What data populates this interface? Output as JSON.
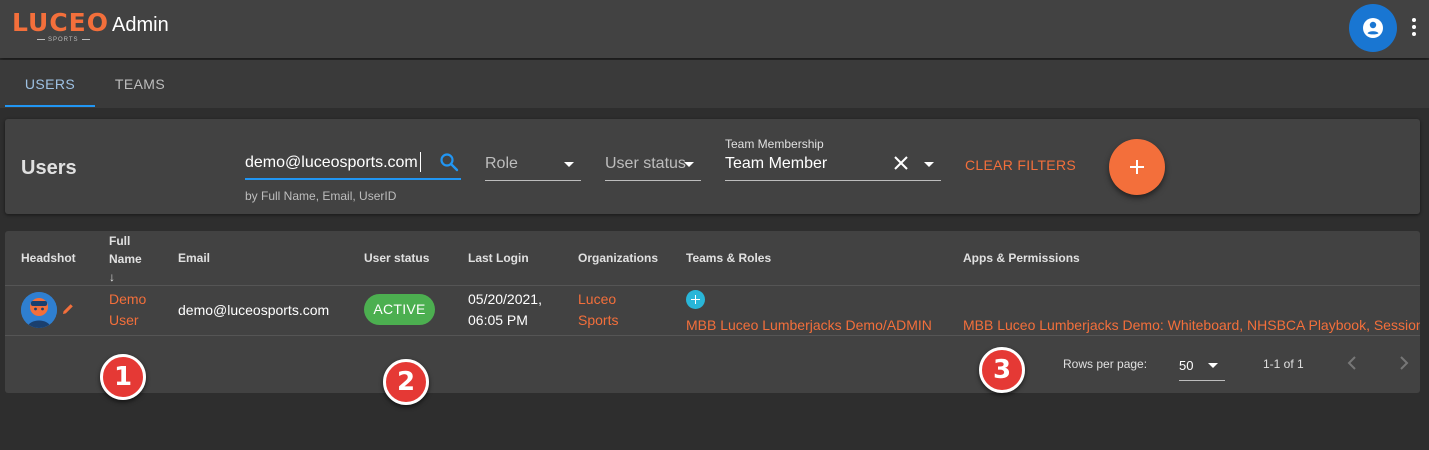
{
  "app": {
    "logo_text": "LUCEO",
    "logo_subtext": "SPORTS",
    "title": "Admin"
  },
  "tabs": [
    {
      "label": "USERS",
      "active": true
    },
    {
      "label": "TEAMS",
      "active": false
    }
  ],
  "filters": {
    "heading": "Users",
    "search_value": "demo@luceosports.com",
    "search_helper": "by Full Name, Email, UserID",
    "role_placeholder": "Role",
    "status_placeholder": "User status",
    "team_label": "Team Membership",
    "team_value": "Team Member",
    "clear_label": "CLEAR FILTERS"
  },
  "table": {
    "headers": {
      "headshot": "Headshot",
      "full_name_line1": "Full",
      "full_name_line2": "Name",
      "sort_arrow": "↓",
      "email": "Email",
      "status": "User status",
      "last_login": "Last Login",
      "organizations": "Organizations",
      "teams_roles": "Teams & Roles",
      "apps_permissions": "Apps & Permissions"
    },
    "rows": [
      {
        "name_line1": "Demo",
        "name_line2": "User",
        "email": "demo@luceosports.com",
        "status": "ACTIVE",
        "last_login_line1": "05/20/2021,",
        "last_login_line2": "06:05 PM",
        "org_line1": "Luceo",
        "org_line2": "Sports",
        "team_role": "MBB Luceo Lumberjacks Demo/ADMIN",
        "apps": "MBB Luceo Lumberjacks Demo: Whiteboard, NHSBCA Playbook, Session Tracker"
      }
    ],
    "pagination": {
      "rows_per_page_label": "Rows per page:",
      "rows_per_page_value": "50",
      "range": "1-1 of 1"
    }
  },
  "callouts": [
    "1",
    "2",
    "3"
  ],
  "colors": {
    "accent": "#f36f3b",
    "primary": "#2196f3",
    "active_chip": "#4caf50",
    "callout": "#e53935"
  }
}
